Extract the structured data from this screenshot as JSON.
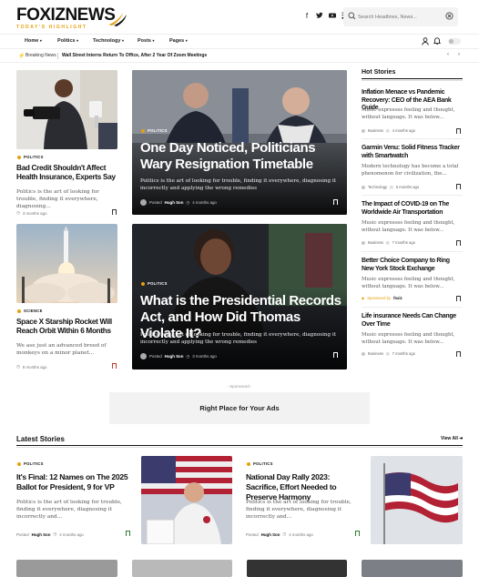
{
  "brand": {
    "name": "FOXIZNEWS",
    "tagline": "TODAY'S HIGHLIGHT",
    "accent": "#e5a00d"
  },
  "header": {
    "search_placeholder": "Search Headlines, News...",
    "socials": [
      "facebook-icon",
      "twitter-icon",
      "youtube-icon",
      "rss-icon"
    ]
  },
  "nav": {
    "items": [
      "Home",
      "Politics",
      "Technology",
      "Posts",
      "Pages"
    ]
  },
  "breaking": {
    "label": "Breaking News",
    "headline": "Wall Street Interns Return To Office, After 2 Year Of Zoom Meetings"
  },
  "left_col": [
    {
      "category": "POLITICS",
      "title": "Bad Credit Shouldn't Affect Health Insurance, Experts Say",
      "excerpt": "Politics is the art of looking for trouble, finding it everywhere, diagnosing...",
      "time": "3 months ago"
    },
    {
      "category": "SCIENCE",
      "title": "Space X Starship Rocket Will Reach Orbit Within 6 Months",
      "excerpt": "We ase just an advanced breed of monkeys on a minor planet...",
      "time": "8 months ago"
    }
  ],
  "hero": [
    {
      "category": "POLITICS",
      "title": "One Day Noticed, Politicians Wary Resignation Timetable",
      "excerpt": "Politics is the art of looking for trouble, finding it everywhere, diagnosing it incorrectly and applying the wrong remedies",
      "posted_label": "Posted",
      "author": "Hugh Son",
      "time": "4 months ago"
    },
    {
      "category": "POLITICS",
      "title": "What is the Presidential Records Act, and How Did Thomas Violate It?",
      "excerpt": "Politics is the art of looking for trouble, finding it everywhere, diagnosing it incorrectly and applying the wrong remedies",
      "posted_label": "Posted",
      "author": "Hugh Son",
      "time": "3 months ago"
    }
  ],
  "hot": {
    "heading": "Hot Stories",
    "items": [
      {
        "title": "Inflation Menace vs Pandemic Recovery: CEO of the AEA Bank Guide",
        "excerpt": "Music expresses feeling and thought, without language. It was below...",
        "category": "Business",
        "time": "4 months ago"
      },
      {
        "title": "Garmin Venu: Solid Fitness Tracker with Smartwatch",
        "excerpt": "Modern technology has become a total phenomenon for civilization, the...",
        "category": "Technology",
        "time": "5 months ago"
      },
      {
        "title": "The Impact of COVID-19 on The Worldwide Air Transportation",
        "excerpt": "Music expresses feeling and thought, without language. It was below...",
        "category": "Business",
        "time": "7 months ago"
      },
      {
        "title": "Better Choice Company to Ring New York Stock Exchange",
        "excerpt": "Music expresses feeling and thought, without language. It was below...",
        "category": "Sponsored by",
        "sponsor": "foxiz",
        "time": ""
      },
      {
        "title": "Life insurance Needs Can Change Over Time",
        "excerpt": "Music expresses feeling and thought, without language. It was below...",
        "category": "Business",
        "time": "7 months ago"
      }
    ]
  },
  "ad": {
    "label": "- Sponsored -",
    "text": "Right Place for Your Ads"
  },
  "latest": {
    "heading": "Latest Stories",
    "view_all": "View All",
    "items": [
      {
        "category": "POLITICS",
        "title": "It's Final: 12 Names on The 2025 Ballot for President, 9 for VP",
        "excerpt": "Politics is the art of looking for trouble, finding it everywhere, diagnosing it incorrectly and...",
        "posted_label": "Posted",
        "author": "Hugh Son",
        "time": "4 months ago"
      },
      {
        "category": "POLITICS",
        "title": "National Day Rally 2023: Sacrifice, Effort Needed to Preserve Harmony",
        "excerpt": "Politics is the art of looking for trouble, finding it everywhere, diagnosing it incorrectly and...",
        "posted_label": "Posted",
        "author": "Hugh Son",
        "time": "4 months ago"
      }
    ]
  }
}
